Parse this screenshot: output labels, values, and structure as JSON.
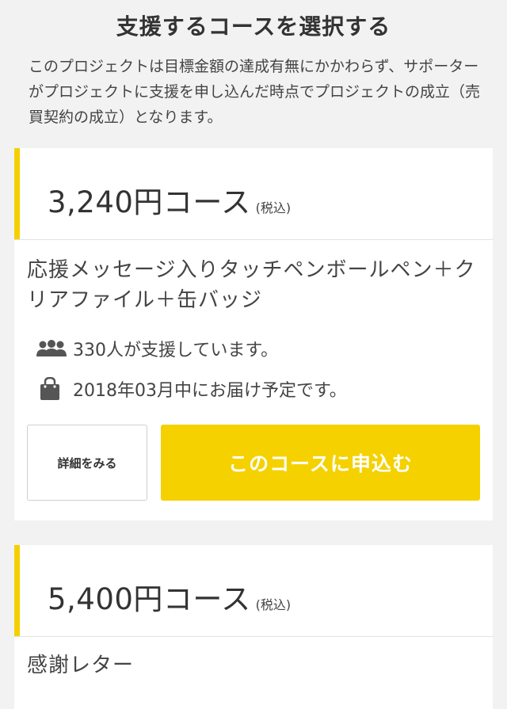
{
  "section": {
    "title": "支援するコースを選択する",
    "notice": "このプロジェクトは目標金額の達成有無にかかわらず、サポーターがプロジェクトに支援を申し込んだ時点でプロジェクトの成立（売買契約の成立）となります。"
  },
  "courses": [
    {
      "price": "3,240円コース",
      "tax": "(税込)",
      "description": "応援メッセージ入りタッチペンボールペン＋クリアファイル＋缶バッジ",
      "supporters": "330人が支援しています。",
      "delivery": "2018年03月中にお届け予定です。",
      "detail_label": "詳細をみる",
      "apply_label": "このコースに申込む"
    },
    {
      "price": "5,400円コース",
      "tax": "(税込)",
      "description": "感謝レター"
    }
  ],
  "icons": {
    "supporters": "people-icon",
    "delivery": "shopping-bag-icon"
  },
  "colors": {
    "accent": "#f5d100",
    "background": "#f2f2f2",
    "card": "#ffffff",
    "text": "#333333"
  }
}
